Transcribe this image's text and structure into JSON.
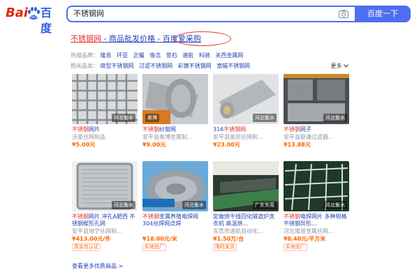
{
  "header": {
    "logo_bai": "Bai",
    "logo_du": "百度",
    "search_value": "不锈钢网",
    "search_button": "百度一下"
  },
  "result": {
    "title_kw": "不锈钢网",
    "title_rest": " - 商品批发价格 - 百度爱采购",
    "hot_label": "热搜品牌：",
    "hot_tags": [
      "隆恩",
      "环亚",
      "正耀",
      "恪浩",
      "誉石",
      "速航",
      "科驰",
      "关西金属网"
    ],
    "related_label": "相关品类：",
    "related_tags": [
      "席型不锈钢网",
      "过滤不锈钢网",
      "彩镀不锈钢网",
      "宽幅不锈钢网"
    ],
    "more": "更多",
    "items": [
      {
        "kw": "不锈钢",
        "title": "网片",
        "shop": "沃豪丝网制品",
        "price": "¥5.00元",
        "watermark": "河北衡水",
        "badge": ""
      },
      {
        "kw": "不锈钢",
        "title": "纱窗网",
        "shop": "安平县奥博金属制...",
        "price": "¥9.00元",
        "watermark": "奥博",
        "badge": ""
      },
      {
        "kw": "316",
        "title": "不锈钢网",
        "shop": "安平县奥邦丝网制...",
        "price": "¥23.00元",
        "watermark": "河北衡水",
        "badge": ""
      },
      {
        "kw": "不锈钢",
        "title": "网子",
        "shop": "安平县联谦过滤器...",
        "price": "¥13.88元",
        "watermark": "河北衡水",
        "badge": ""
      },
      {
        "kw": "不锈钢",
        "title": "网片 冲孔A肥西 不锈钢楔形孔网",
        "shop": "安平县旭宁丝网制...",
        "price": "¥413.00元/件",
        "watermark": "河北衡水",
        "badge": "真实性认证"
      },
      {
        "kw": "不锈钢",
        "title": "金属养殖电焊网304丝焊网点焊",
        "shop": "安平县誉石丝网制...",
        "price": "¥18.00元/米",
        "watermark": "河北衡水",
        "badge": "实地验厂"
      },
      {
        "kw": "定做",
        "title": "烘干线回化隧道炉洗衣机 高温烘...",
        "shop": "东莞市速航自动化...",
        "price": "¥1.50万/台",
        "watermark": "广东东莞",
        "badge": "限时发货"
      },
      {
        "kw": "不锈钢",
        "title": "电焊网片 多种规格 不锈钢异形...",
        "shop": "河北隆恩金属丝网...",
        "price": "¥8.40元/平方米",
        "watermark": "河北衡水",
        "badge": "实地验厂"
      }
    ],
    "see_more": "查看更多优质商品 >"
  }
}
